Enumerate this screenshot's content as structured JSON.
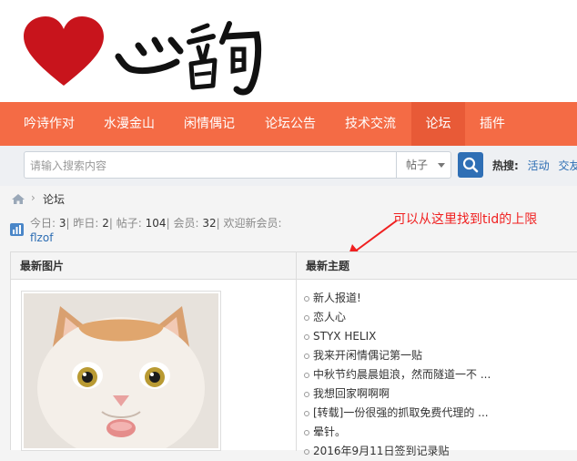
{
  "nav": {
    "items": [
      {
        "label": "吟诗作对",
        "active": false
      },
      {
        "label": "水漫金山",
        "active": false
      },
      {
        "label": "闲情偶记",
        "active": false
      },
      {
        "label": "论坛公告",
        "active": false
      },
      {
        "label": "技术交流",
        "active": false
      },
      {
        "label": "论坛",
        "active": true
      },
      {
        "label": "插件",
        "active": false
      }
    ],
    "colors": {
      "bar": "#f46b45",
      "active": "#e85a37"
    }
  },
  "search": {
    "placeholder": "请输入搜索内容",
    "value": "",
    "type_label": "帖子",
    "hot_label": "热搜:",
    "hot_links": [
      "活动",
      "交友"
    ]
  },
  "breadcrumb": {
    "current": "论坛"
  },
  "stats": {
    "today_label": "今日:",
    "today": "3",
    "yesterday_label": "昨日:",
    "yesterday": "2",
    "posts_label": "帖子:",
    "posts": "104",
    "members_label": "会员:",
    "members": "32",
    "welcome_label": "欢迎新会员:",
    "new_member": "flzof"
  },
  "annotation": {
    "text": "可以从这里找到tid的上限",
    "color": "#f02020"
  },
  "panels": {
    "pictures_title": "最新图片",
    "topics_title": "最新主题",
    "topics": [
      "新人报道!",
      "恋人心",
      "STYX HELIX",
      "我来开闲情偶记第一贴",
      "中秋节约晨晨姐浪，然而隧道一不 ...",
      "我想回家啊啊啊",
      "[转载]一份很强的抓取免费代理的 ...",
      "晕针。",
      "2016年9月11日签到记录贴"
    ]
  },
  "icons": [
    "home-icon",
    "search-icon",
    "stats-icon",
    "chevron-down-icon",
    "heart-icon"
  ]
}
